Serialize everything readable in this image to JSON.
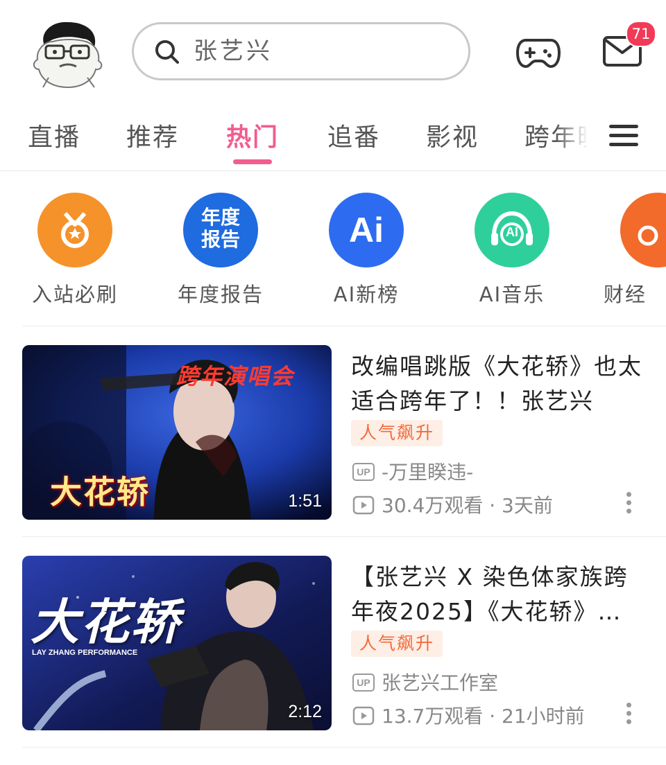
{
  "header": {
    "search_text": "张艺兴",
    "mail_badge": "71"
  },
  "tabs": [
    {
      "label": "直播"
    },
    {
      "label": "推荐"
    },
    {
      "label": "热门",
      "active": true
    },
    {
      "label": "追番"
    },
    {
      "label": "影视"
    },
    {
      "label": "跨年晚会"
    }
  ],
  "shortcuts": [
    {
      "label": "入站必刷",
      "color": "#f5922a",
      "icon": "medal-icon"
    },
    {
      "label": "年度报告",
      "color": "#1f6be0",
      "icon_text": "年度\n报告"
    },
    {
      "label": "AI新榜",
      "color": "#2d6cf0",
      "icon_text": "Ai"
    },
    {
      "label": "AI音乐",
      "color": "#2fcf9b",
      "icon_text": "AI"
    },
    {
      "label": "财经",
      "color": "#f26b2a",
      "icon": "finance-icon"
    }
  ],
  "videos": [
    {
      "title": "改编唱跳版《大花轿》也太适合跨年了！！张艺兴",
      "badge": "人气飙升",
      "uploader": "-万里睽违-",
      "views": "30.4万观看 · 3天前",
      "duration": "1:51",
      "thumb_text_top": "跨年演唱会",
      "thumb_text_main": "大花轿",
      "thumb_color": "#1a3aa8"
    },
    {
      "title": "【张艺兴 X 染色体家族跨年夜2025】《大花轿》…",
      "badge": "人气飙升",
      "uploader": "张艺兴工作室",
      "views": "13.7万观看 · 21小时前",
      "duration": "2:12",
      "thumb_text_main": "大花轿",
      "thumb_text_sub": "LAY ZHANG PERFORMANCE",
      "thumb_color": "#121a55"
    }
  ],
  "up_label": "UP"
}
